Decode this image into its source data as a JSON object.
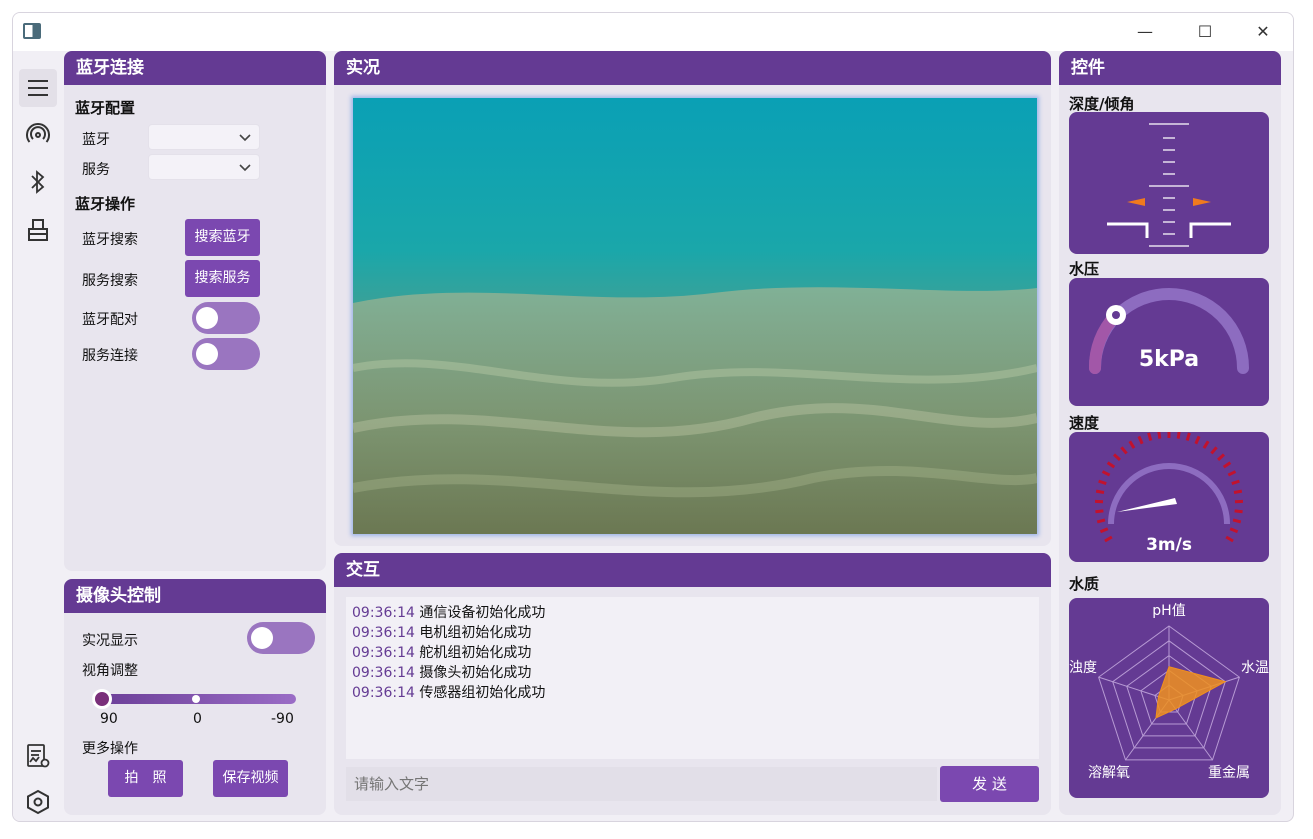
{
  "window": {
    "buttons": {
      "minimize": "—",
      "maximize": "☐",
      "close": "✕"
    }
  },
  "rail": {
    "icons": [
      "menu-icon",
      "signal-icon",
      "bluetooth-icon",
      "usb-icon",
      "log-settings-icon",
      "settings-hex-icon"
    ]
  },
  "bluetooth": {
    "title": "蓝牙连接",
    "config_title": "蓝牙配置",
    "bt_label": "蓝牙",
    "bt_value": "",
    "service_label": "服务",
    "service_value": "",
    "ops_title": "蓝牙操作",
    "search_bt_label": "蓝牙搜索",
    "search_bt_button": "搜索蓝牙",
    "search_service_label": "服务搜索",
    "search_service_button": "搜索服务",
    "pair_label": "蓝牙配对",
    "pair_on": false,
    "connect_label": "服务连接",
    "connect_on": false
  },
  "camera": {
    "title": "摄像头控制",
    "live_label": "实况显示",
    "live_on": false,
    "angle_label": "视角调整",
    "slider_ticks": [
      "90",
      "0",
      "-90"
    ],
    "angle_value": 90,
    "more_label": "更多操作",
    "photo_button": "拍　照",
    "save_video_button": "保存视频"
  },
  "live": {
    "title": "实况"
  },
  "interact": {
    "title": "交互",
    "log": [
      {
        "time": "09:36:14",
        "msg": "通信设备初始化成功"
      },
      {
        "time": "09:36:14",
        "msg": "电机组初始化成功"
      },
      {
        "time": "09:36:14",
        "msg": "舵机组初始化成功"
      },
      {
        "time": "09:36:14",
        "msg": "摄像头初始化成功"
      },
      {
        "time": "09:36:14",
        "msg": "传感器组初始化成功"
      }
    ],
    "input_placeholder": "请输入文字",
    "send_button": "发 送"
  },
  "controls": {
    "title": "控件",
    "depth_label": "深度/倾角",
    "pressure_label": "水压",
    "pressure_value": "5kPa",
    "pressure_fraction": 0.05,
    "speed_label": "速度",
    "speed_value": "3m/s",
    "water_label": "水质",
    "radar_axes": [
      "pH值",
      "水温",
      "重金属",
      "溶解氧",
      "浊度"
    ],
    "radar_values": [
      0.45,
      0.8,
      0.15,
      0.3,
      0.15
    ]
  },
  "colors": {
    "accent": "#643a93",
    "button": "#7b48b0",
    "toggle": "#9a75c0",
    "panel": "#e8e5ee",
    "radar_fill": "#f0901e"
  }
}
